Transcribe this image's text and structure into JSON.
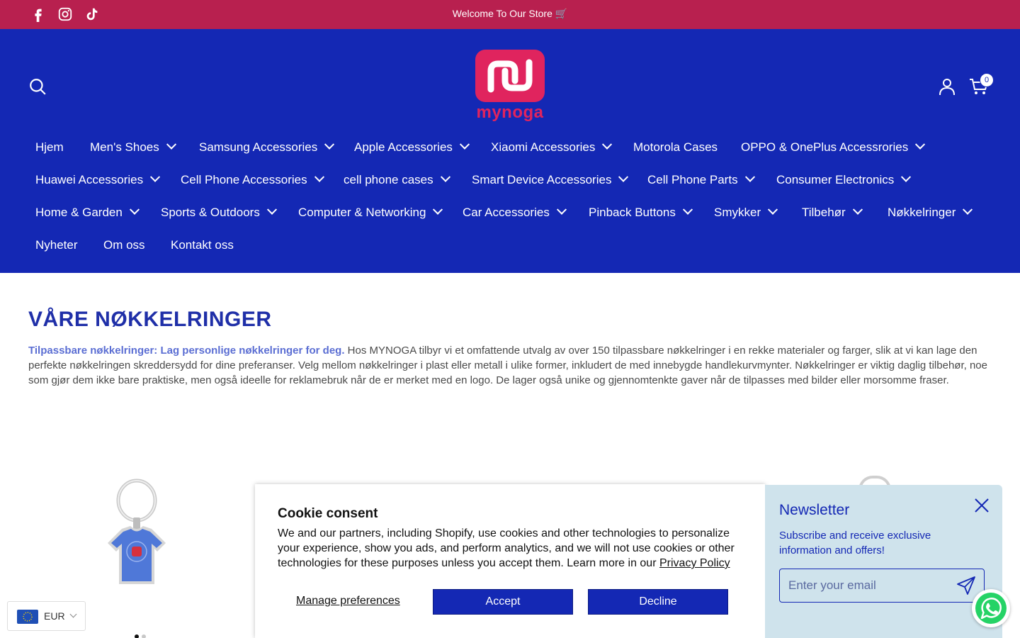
{
  "announcement": {
    "text": "Welcome To Our Store 🛒",
    "social": [
      "facebook-icon",
      "instagram-icon",
      "tiktok-icon"
    ],
    "background": "#b8204f"
  },
  "header": {
    "background": "#1428b4",
    "logo_text": "mynoga",
    "cart_count": "0"
  },
  "nav": {
    "row1": [
      "Hjem",
      "Men's Shoes",
      "Samsung Accessories",
      "Apple Accessories",
      "Xiaomi Accessories",
      "Motorola Cases",
      "OPPO & OnePlus Accessrories"
    ],
    "row2": [
      "Huawei Accessories",
      "Cell Phone Accessories",
      "cell phone cases",
      "Smart Device Accessories",
      "Cell Phone Parts",
      "Consumer Electronics"
    ],
    "row3": [
      "Home & Garden",
      "Sports & Outdoors",
      "Computer & Networking",
      "Car Accessories",
      "Pinback Buttons",
      "Smykker",
      "Tilbehør",
      "Nøkkelringer"
    ],
    "row4": [
      "Nyheter",
      "Om oss",
      "Kontakt oss"
    ]
  },
  "main": {
    "title": "VÅRE NØKKELRINGER",
    "intro_bold": "Tilpassbare nøkkelringer: Lag personlige nøkkelringer for deg.",
    "intro_text": " Hos MYNOGA tilbyr vi et omfattende utvalg av over 150 tilpassbare nøkkelringer i en rekke materialer og farger, slik at vi kan lage den perfekte nøkkelringen skreddersydd for dine preferanser. Velg mellom nøkkelringer i plast eller metall i ulike former, inkludert de med innebygde handlekurvmynter. Nøkkelringer er viktig daglig tilbehør, noe som gjør dem ikke bare praktiske, men også ideelle for reklamebruk når de er merket med en logo. De lager også unike og gjennomtenkte gaver når de tilpasses med bilder eller morsomme fraser."
  },
  "cookie": {
    "title": "Cookie consent",
    "body": "We and our partners, including Shopify, use cookies and other technologies to personalize your experience, show you ads, and perform analytics, and we will not use cookies or other technologies for these purposes unless you accept them. Learn more in our ",
    "link": "Privacy Policy",
    "manage": "Manage preferences",
    "accept": "Accept",
    "decline": "Decline"
  },
  "newsletter": {
    "title": "Newsletter",
    "text": "Subscribe and receive exclusive information and offers!",
    "placeholder": "Enter your email"
  },
  "currency": {
    "label": "EUR"
  }
}
